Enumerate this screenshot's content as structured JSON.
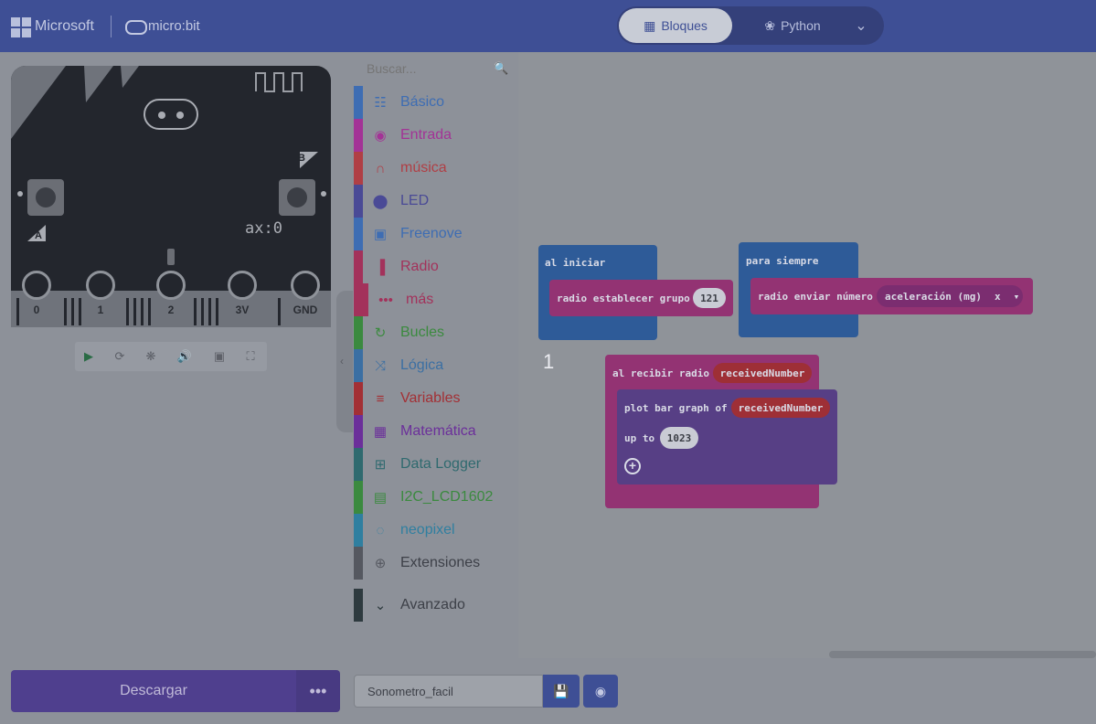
{
  "header": {
    "ms_text": "Microsoft",
    "microbit_text": "micro:bit",
    "tab_blocks": "Bloques",
    "tab_python": "Python",
    "color": "#3e4f95"
  },
  "simulator": {
    "pins": [
      "0",
      "1",
      "2",
      "3V",
      "GND"
    ],
    "button_a": "A",
    "button_b": "B",
    "accel_readout": "ax:0",
    "tools": [
      "play-icon",
      "restart-icon",
      "debug-icon",
      "sound-icon",
      "screenshot-icon",
      "fullscreen-icon"
    ]
  },
  "toolbox": {
    "search_placeholder": "Buscar...",
    "categories": [
      {
        "label": "Básico",
        "color": "#3e6db3",
        "icon": "grid-icon"
      },
      {
        "label": "Entrada",
        "color": "#a33396",
        "icon": "target-icon"
      },
      {
        "label": "música",
        "color": "#b03f45",
        "icon": "headphones-icon"
      },
      {
        "label": "LED",
        "color": "#4a4a96",
        "icon": "toggle-icon"
      },
      {
        "label": "Freenove",
        "color": "#3e6db3",
        "icon": "chip-icon"
      },
      {
        "label": "Radio",
        "color": "#a3325b",
        "icon": "signal-icon"
      },
      {
        "label": "más",
        "color": "#a3325b",
        "icon": "dots-icon"
      },
      {
        "label": "Bucles",
        "color": "#3b8a3f",
        "icon": "loop-icon"
      },
      {
        "label": "Lógica",
        "color": "#3b6fa3",
        "icon": "shuffle-icon"
      },
      {
        "label": "Variables",
        "color": "#a33035",
        "icon": "lines-icon"
      },
      {
        "label": "Matemática",
        "color": "#6b2f9a",
        "icon": "calculator-icon"
      },
      {
        "label": "Data Logger",
        "color": "#2f6a6f",
        "icon": "table-icon"
      },
      {
        "label": "I2C_LCD1602",
        "color": "#3b8a3f",
        "icon": "lcd-icon"
      },
      {
        "label": "neopixel",
        "color": "#2f7fa0",
        "icon": "ring-icon"
      },
      {
        "label": "Extensiones",
        "color": "#555860",
        "icon": "plus-circle-icon"
      },
      {
        "label": "Avanzado",
        "color": "#2e3a3f",
        "icon": "chevron-down-icon"
      }
    ]
  },
  "workspace": {
    "on_start": {
      "label": "al iniciar",
      "inner": "radio establecer grupo",
      "value": "121"
    },
    "forever": {
      "label": "para siempre",
      "inner": "radio enviar número",
      "arg": "aceleración (mg)",
      "axis": "x"
    },
    "on_receive": {
      "label": "al recibir radio",
      "var": "receivedNumber",
      "inner": "plot bar graph of",
      "inner_var": "receivedNumber",
      "up_to": "up to",
      "up_to_value": "1023"
    },
    "count_label": "1"
  },
  "footer": {
    "download": "Descargar",
    "more": "•••",
    "project_name": "Sonometro_facil"
  }
}
